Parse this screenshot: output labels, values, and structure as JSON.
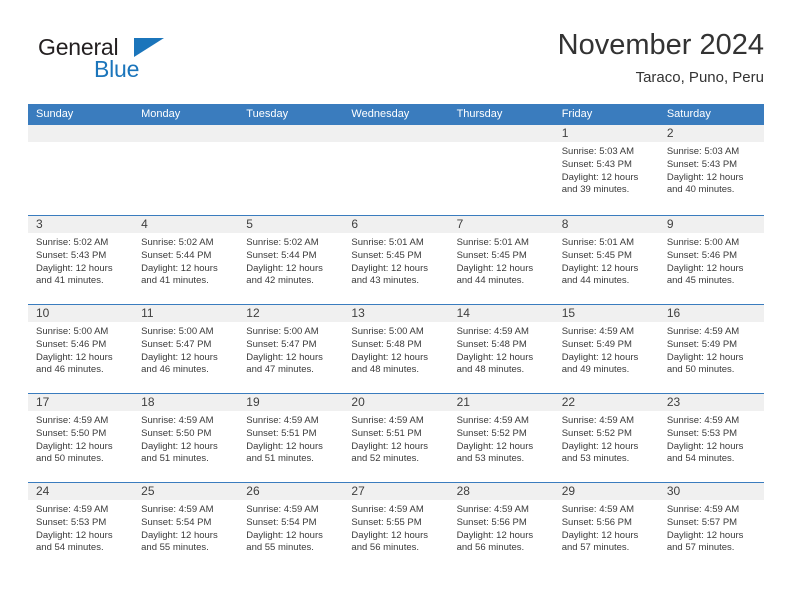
{
  "brand": {
    "name_part1": "General",
    "name_part2": "Blue",
    "triangle_color": "#1b75bb"
  },
  "header": {
    "title": "November 2024",
    "subtitle": "Taraco, Puno, Peru"
  },
  "theme": {
    "header_blue": "#3a7cbe",
    "date_strip_gray": "#f0f0f0",
    "text_color": "#3a3a3a"
  },
  "weekdays": [
    "Sunday",
    "Monday",
    "Tuesday",
    "Wednesday",
    "Thursday",
    "Friday",
    "Saturday"
  ],
  "weeks": [
    [
      {
        "day": "",
        "lines": []
      },
      {
        "day": "",
        "lines": []
      },
      {
        "day": "",
        "lines": []
      },
      {
        "day": "",
        "lines": []
      },
      {
        "day": "",
        "lines": []
      },
      {
        "day": "1",
        "lines": [
          "Sunrise: 5:03 AM",
          "Sunset: 5:43 PM",
          "Daylight: 12 hours",
          "and 39 minutes."
        ]
      },
      {
        "day": "2",
        "lines": [
          "Sunrise: 5:03 AM",
          "Sunset: 5:43 PM",
          "Daylight: 12 hours",
          "and 40 minutes."
        ]
      }
    ],
    [
      {
        "day": "3",
        "lines": [
          "Sunrise: 5:02 AM",
          "Sunset: 5:43 PM",
          "Daylight: 12 hours",
          "and 41 minutes."
        ]
      },
      {
        "day": "4",
        "lines": [
          "Sunrise: 5:02 AM",
          "Sunset: 5:44 PM",
          "Daylight: 12 hours",
          "and 41 minutes."
        ]
      },
      {
        "day": "5",
        "lines": [
          "Sunrise: 5:02 AM",
          "Sunset: 5:44 PM",
          "Daylight: 12 hours",
          "and 42 minutes."
        ]
      },
      {
        "day": "6",
        "lines": [
          "Sunrise: 5:01 AM",
          "Sunset: 5:45 PM",
          "Daylight: 12 hours",
          "and 43 minutes."
        ]
      },
      {
        "day": "7",
        "lines": [
          "Sunrise: 5:01 AM",
          "Sunset: 5:45 PM",
          "Daylight: 12 hours",
          "and 44 minutes."
        ]
      },
      {
        "day": "8",
        "lines": [
          "Sunrise: 5:01 AM",
          "Sunset: 5:45 PM",
          "Daylight: 12 hours",
          "and 44 minutes."
        ]
      },
      {
        "day": "9",
        "lines": [
          "Sunrise: 5:00 AM",
          "Sunset: 5:46 PM",
          "Daylight: 12 hours",
          "and 45 minutes."
        ]
      }
    ],
    [
      {
        "day": "10",
        "lines": [
          "Sunrise: 5:00 AM",
          "Sunset: 5:46 PM",
          "Daylight: 12 hours",
          "and 46 minutes."
        ]
      },
      {
        "day": "11",
        "lines": [
          "Sunrise: 5:00 AM",
          "Sunset: 5:47 PM",
          "Daylight: 12 hours",
          "and 46 minutes."
        ]
      },
      {
        "day": "12",
        "lines": [
          "Sunrise: 5:00 AM",
          "Sunset: 5:47 PM",
          "Daylight: 12 hours",
          "and 47 minutes."
        ]
      },
      {
        "day": "13",
        "lines": [
          "Sunrise: 5:00 AM",
          "Sunset: 5:48 PM",
          "Daylight: 12 hours",
          "and 48 minutes."
        ]
      },
      {
        "day": "14",
        "lines": [
          "Sunrise: 4:59 AM",
          "Sunset: 5:48 PM",
          "Daylight: 12 hours",
          "and 48 minutes."
        ]
      },
      {
        "day": "15",
        "lines": [
          "Sunrise: 4:59 AM",
          "Sunset: 5:49 PM",
          "Daylight: 12 hours",
          "and 49 minutes."
        ]
      },
      {
        "day": "16",
        "lines": [
          "Sunrise: 4:59 AM",
          "Sunset: 5:49 PM",
          "Daylight: 12 hours",
          "and 50 minutes."
        ]
      }
    ],
    [
      {
        "day": "17",
        "lines": [
          "Sunrise: 4:59 AM",
          "Sunset: 5:50 PM",
          "Daylight: 12 hours",
          "and 50 minutes."
        ]
      },
      {
        "day": "18",
        "lines": [
          "Sunrise: 4:59 AM",
          "Sunset: 5:50 PM",
          "Daylight: 12 hours",
          "and 51 minutes."
        ]
      },
      {
        "day": "19",
        "lines": [
          "Sunrise: 4:59 AM",
          "Sunset: 5:51 PM",
          "Daylight: 12 hours",
          "and 51 minutes."
        ]
      },
      {
        "day": "20",
        "lines": [
          "Sunrise: 4:59 AM",
          "Sunset: 5:51 PM",
          "Daylight: 12 hours",
          "and 52 minutes."
        ]
      },
      {
        "day": "21",
        "lines": [
          "Sunrise: 4:59 AM",
          "Sunset: 5:52 PM",
          "Daylight: 12 hours",
          "and 53 minutes."
        ]
      },
      {
        "day": "22",
        "lines": [
          "Sunrise: 4:59 AM",
          "Sunset: 5:52 PM",
          "Daylight: 12 hours",
          "and 53 minutes."
        ]
      },
      {
        "day": "23",
        "lines": [
          "Sunrise: 4:59 AM",
          "Sunset: 5:53 PM",
          "Daylight: 12 hours",
          "and 54 minutes."
        ]
      }
    ],
    [
      {
        "day": "24",
        "lines": [
          "Sunrise: 4:59 AM",
          "Sunset: 5:53 PM",
          "Daylight: 12 hours",
          "and 54 minutes."
        ]
      },
      {
        "day": "25",
        "lines": [
          "Sunrise: 4:59 AM",
          "Sunset: 5:54 PM",
          "Daylight: 12 hours",
          "and 55 minutes."
        ]
      },
      {
        "day": "26",
        "lines": [
          "Sunrise: 4:59 AM",
          "Sunset: 5:54 PM",
          "Daylight: 12 hours",
          "and 55 minutes."
        ]
      },
      {
        "day": "27",
        "lines": [
          "Sunrise: 4:59 AM",
          "Sunset: 5:55 PM",
          "Daylight: 12 hours",
          "and 56 minutes."
        ]
      },
      {
        "day": "28",
        "lines": [
          "Sunrise: 4:59 AM",
          "Sunset: 5:56 PM",
          "Daylight: 12 hours",
          "and 56 minutes."
        ]
      },
      {
        "day": "29",
        "lines": [
          "Sunrise: 4:59 AM",
          "Sunset: 5:56 PM",
          "Daylight: 12 hours",
          "and 57 minutes."
        ]
      },
      {
        "day": "30",
        "lines": [
          "Sunrise: 4:59 AM",
          "Sunset: 5:57 PM",
          "Daylight: 12 hours",
          "and 57 minutes."
        ]
      }
    ]
  ]
}
